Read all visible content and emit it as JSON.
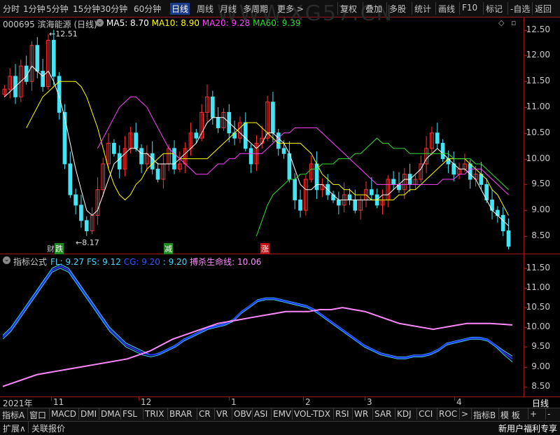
{
  "toolbar": {
    "left_tabs": [
      "分时",
      "1分钟",
      "5分钟",
      "15分钟",
      "30分钟",
      "60分钟",
      "日线",
      "周线",
      "月线",
      "多周期",
      "更多 >"
    ],
    "active_tab": "日线",
    "right_tabs": [
      "复权",
      "叠加",
      "多股",
      "统计",
      "画线",
      "F10",
      "标记",
      "-自选",
      "返回"
    ]
  },
  "watermark": "WWW.XG57.CN",
  "header": {
    "code_name": "000695 滨海能源 (日线)",
    "ma": [
      {
        "label": "MA5: 8.70",
        "color": "#ffffff"
      },
      {
        "label": "MA10: 8.90",
        "color": "#ffff00"
      },
      {
        "label": "MA20: 9.28",
        "color": "#ff44ff"
      },
      {
        "label": "MA60: 9.39",
        "color": "#33dd33"
      }
    ]
  },
  "price_axis": {
    "ticks": [
      "12.50",
      "12.00",
      "11.50",
      "11.00",
      "10.50",
      "10.00",
      "9.50",
      "9.00",
      "8.50"
    ],
    "min": 8.2,
    "max": 12.7
  },
  "annotations": {
    "high": "12.51",
    "low": "8.17",
    "sig1": "跌",
    "sig1_prefix": "财",
    "sig2": "减",
    "sig3": "涨"
  },
  "indicator": {
    "header_name": "指标公式",
    "fields": [
      {
        "label": "FL: 9.27",
        "color": "#3fd8ff"
      },
      {
        "label": "FS: 9.12",
        "color": "#3fd8ff"
      },
      {
        "label": "CG: 9.20",
        "color": "#3355ff"
      },
      {
        "label": ": 9.20",
        "color": "#3fd8ff"
      },
      {
        "label": "搏杀生命线: 10.06",
        "color": "#ff88ff"
      }
    ],
    "ticks": [
      "11.50",
      "11.00",
      "10.50",
      "10.00",
      "9.50",
      "9.00",
      "8.50"
    ],
    "min": 8.3,
    "max": 11.8
  },
  "date_axis": {
    "labels": [
      "2021年",
      "11",
      "12",
      "1",
      "2",
      "3",
      "4"
    ],
    "right_label": "日线"
  },
  "tabs": [
    "指标A",
    "窗口",
    "MACD",
    "DMI",
    "DMA",
    "FSL",
    "TRIX",
    "BRAR",
    "CR",
    "VR",
    "OBV",
    "ASI",
    "EMV",
    "VOL-TDX",
    "RSI",
    "WR",
    "SAR",
    "KDJ",
    "CCI",
    "ROC",
    ">",
    "指标B",
    "模 板",
    "+",
    "-"
  ],
  "status": {
    "left": [
      "扩展∧",
      "关联报价"
    ],
    "right": "新用户福利专享"
  },
  "chart_data": [
    {
      "type": "candlestick",
      "title": "000695 滨海能源 (日线)",
      "ylim": [
        8.2,
        12.7
      ],
      "series": [
        {
          "name": "close",
          "values": [
            11.35,
            11.6,
            11.2,
            11.8,
            11.5,
            12.2,
            11.7,
            11.4,
            12.3,
            11.6,
            10.9,
            9.9,
            9.3,
            9.1,
            8.8,
            8.6,
            8.9,
            9.4,
            9.9,
            10.3,
            10.1,
            9.8,
            10.2,
            10.5,
            10.2,
            9.9,
            10.1,
            9.8,
            9.6,
            9.9,
            10.2,
            9.8,
            9.9,
            10.2,
            10.5,
            10.4,
            10.9,
            11.2,
            10.8,
            10.6,
            10.9,
            10.5,
            10.4,
            10.7,
            10.2,
            9.9,
            10.3,
            10.4,
            11.1,
            10.5,
            10.2,
            10.1,
            9.6,
            9.2,
            9.0,
            9.6,
            9.9,
            9.4,
            9.5,
            9.3,
            9.2,
            9.1,
            9.3,
            9.2,
            9.0,
            9.2,
            9.4,
            9.3,
            9.1,
            9.2,
            9.6,
            9.5,
            9.4,
            9.7,
            9.5,
            9.6,
            9.9,
            10.2,
            10.5,
            10.3,
            10.0,
            9.9,
            9.7,
            9.8,
            9.9,
            9.6,
            9.7,
            9.5,
            9.2,
            9.0,
            8.9,
            8.6,
            8.3
          ]
        },
        {
          "name": "MA5",
          "values": [
            11.2,
            11.3,
            11.4,
            11.5,
            11.6,
            11.8,
            11.7,
            11.6,
            11.7,
            11.5,
            11.2,
            10.8,
            10.3,
            9.8,
            9.4,
            9.0,
            8.9,
            9.0,
            9.3,
            9.6,
            9.9,
            10.0,
            10.1,
            10.2,
            10.2,
            10.1,
            10.1,
            10.0,
            9.9,
            9.9,
            9.9,
            9.9,
            10.0,
            10.1,
            10.2,
            10.3,
            10.5,
            10.7,
            10.8,
            10.8,
            10.8,
            10.7,
            10.6,
            10.5,
            10.4,
            10.3,
            10.2,
            10.3,
            10.5,
            10.5,
            10.4,
            10.3,
            10.1,
            9.8,
            9.5,
            9.4,
            9.4,
            9.5,
            9.5,
            9.4,
            9.3,
            9.2,
            9.2,
            9.2,
            9.2,
            9.2,
            9.2,
            9.2,
            9.2,
            9.3,
            9.3,
            9.4,
            9.5,
            9.6,
            9.6,
            9.7,
            9.8,
            10.0,
            10.1,
            10.2,
            10.1,
            10.0,
            9.9,
            9.8,
            9.8,
            9.7,
            9.6,
            9.4,
            9.2,
            9.0,
            8.9,
            8.8,
            8.7
          ]
        },
        {
          "name": "MA10",
          "values": [
            10.6,
            10.8,
            11.0,
            11.2,
            11.3,
            11.4,
            11.5,
            11.5,
            11.5,
            11.5,
            11.4,
            11.2,
            10.9,
            10.6,
            10.2,
            9.8,
            9.5,
            9.3,
            9.2,
            9.3,
            9.5,
            9.6,
            9.8,
            9.9,
            10.0,
            10.1,
            10.1,
            10.1,
            10.0,
            10.0,
            10.0,
            10.0,
            10.0,
            10.0,
            10.1,
            10.2,
            10.3,
            10.4,
            10.5,
            10.6,
            10.7,
            10.7,
            10.7,
            10.6,
            10.5,
            10.4,
            10.3,
            10.3,
            10.3,
            10.3,
            10.3,
            10.2,
            10.1,
            9.9,
            9.7,
            9.6,
            9.5,
            9.5,
            9.4,
            9.4,
            9.3,
            9.3,
            9.3,
            9.2,
            9.2,
            9.2,
            9.2,
            9.2,
            9.3,
            9.3,
            9.4,
            9.4,
            9.5,
            9.6,
            9.7,
            9.8,
            9.9,
            10.0,
            10.0,
            10.0,
            10.0,
            9.9,
            9.8,
            9.7,
            9.6,
            9.4,
            9.3,
            9.1,
            8.9
          ]
        },
        {
          "name": "MA20",
          "values": [
            10.2,
            10.4,
            10.6,
            10.8,
            11.0,
            11.1,
            11.2,
            11.2,
            11.1,
            11.0,
            10.8,
            10.6,
            10.4,
            10.2,
            10.1,
            10.0,
            9.9,
            9.8,
            9.7,
            9.7,
            9.7,
            9.8,
            9.9,
            9.9,
            10.0,
            10.0,
            10.1,
            10.1,
            10.1,
            10.1,
            10.1,
            10.2,
            10.3,
            10.4,
            10.5,
            10.5,
            10.6,
            10.6,
            10.6,
            10.6,
            10.6,
            10.5,
            10.4,
            10.3,
            10.2,
            10.1,
            10.0,
            9.9,
            9.8,
            9.7,
            9.6,
            9.5,
            9.5,
            9.5,
            9.5,
            9.5,
            9.5,
            9.5,
            9.5,
            9.5,
            9.5,
            9.5,
            9.5,
            9.6,
            9.6,
            9.6,
            9.7,
            9.7,
            9.8,
            9.8,
            9.8,
            9.7,
            9.6,
            9.5,
            9.4,
            9.3
          ]
        },
        {
          "name": "MA60",
          "values": [
            8.5,
            8.8,
            9.1,
            9.3,
            9.4,
            9.5,
            9.6,
            9.6,
            9.7,
            9.7,
            9.8,
            9.8,
            9.9,
            9.9,
            9.9,
            10.0,
            10.0,
            10.0,
            10.1,
            10.1,
            10.2,
            10.3,
            10.4,
            10.3,
            10.3,
            10.2,
            10.2,
            10.2,
            10.1,
            10.1,
            10.1,
            10.1,
            10.1,
            10.1,
            10.1,
            10.1,
            10.0,
            10.0,
            10.0,
            10.0,
            9.9,
            9.9,
            9.8,
            9.7,
            9.6,
            9.5,
            9.4
          ]
        }
      ]
    },
    {
      "type": "line",
      "title": "指标公式",
      "ylim": [
        8.3,
        11.8
      ],
      "series": [
        {
          "name": "FL",
          "values": [
            9.8,
            10.0,
            10.3,
            10.6,
            10.9,
            11.2,
            11.5,
            11.6,
            11.5,
            11.2,
            10.9,
            10.6,
            10.3,
            10.0,
            9.8,
            9.6,
            9.5,
            9.4,
            9.3,
            9.35,
            9.45,
            9.55,
            9.7,
            9.8,
            9.9,
            10.0,
            10.05,
            10.1,
            10.2,
            10.4,
            10.55,
            10.7,
            10.75,
            10.75,
            10.7,
            10.65,
            10.6,
            10.55,
            10.45,
            10.3,
            10.15,
            10.0,
            9.85,
            9.7,
            9.55,
            9.45,
            9.35,
            9.3,
            9.25,
            9.25,
            9.3,
            9.3,
            9.35,
            9.45,
            9.6,
            9.65,
            9.7,
            9.75,
            9.75,
            9.7,
            9.55,
            9.4,
            9.27
          ]
        },
        {
          "name": "FS",
          "values": [
            9.7,
            9.9,
            10.2,
            10.5,
            10.8,
            11.1,
            11.4,
            11.5,
            11.4,
            11.1,
            10.8,
            10.5,
            10.2,
            9.9,
            9.7,
            9.5,
            9.4,
            9.3,
            9.25,
            9.3,
            9.4,
            9.5,
            9.65,
            9.75,
            9.85,
            9.95,
            10.0,
            10.05,
            10.15,
            10.35,
            10.5,
            10.65,
            10.7,
            10.7,
            10.65,
            10.6,
            10.55,
            10.5,
            10.4,
            10.25,
            10.1,
            9.95,
            9.8,
            9.65,
            9.5,
            9.4,
            9.3,
            9.25,
            9.2,
            9.2,
            9.25,
            9.25,
            9.3,
            9.4,
            9.55,
            9.6,
            9.65,
            9.7,
            9.7,
            9.65,
            9.5,
            9.3,
            9.12
          ]
        },
        {
          "name": "CG",
          "values": [
            9.75,
            9.95,
            10.25,
            10.55,
            10.85,
            11.15,
            11.45,
            11.55,
            11.45,
            11.15,
            10.85,
            10.55,
            10.25,
            9.95,
            9.75,
            9.55,
            9.45,
            9.35,
            9.3,
            9.33,
            9.43,
            9.53,
            9.68,
            9.78,
            9.88,
            9.98,
            10.03,
            10.08,
            10.18,
            10.38,
            10.53,
            10.68,
            10.73,
            10.73,
            10.68,
            10.63,
            10.58,
            10.53,
            10.43,
            10.28,
            10.13,
            9.98,
            9.83,
            9.68,
            9.53,
            9.43,
            9.33,
            9.28,
            9.23,
            9.23,
            9.28,
            9.28,
            9.33,
            9.43,
            9.58,
            9.63,
            9.68,
            9.73,
            9.73,
            9.68,
            9.53,
            9.35,
            9.2
          ]
        },
        {
          "name": "搏杀生命线",
          "values": [
            8.5,
            8.6,
            8.7,
            8.8,
            8.85,
            8.9,
            8.95,
            9.0,
            9.05,
            9.1,
            9.15,
            9.2,
            9.3,
            9.4,
            9.55,
            9.7,
            9.8,
            9.9,
            10.0,
            10.1,
            10.15,
            10.2,
            10.25,
            10.3,
            10.35,
            10.4,
            10.4,
            10.4,
            10.45,
            10.45,
            10.5,
            10.45,
            10.4,
            10.3,
            10.2,
            10.1,
            10.05,
            10.0,
            9.95,
            10.0,
            10.05,
            10.1,
            10.1,
            10.1,
            10.08,
            10.06
          ]
        }
      ]
    }
  ]
}
